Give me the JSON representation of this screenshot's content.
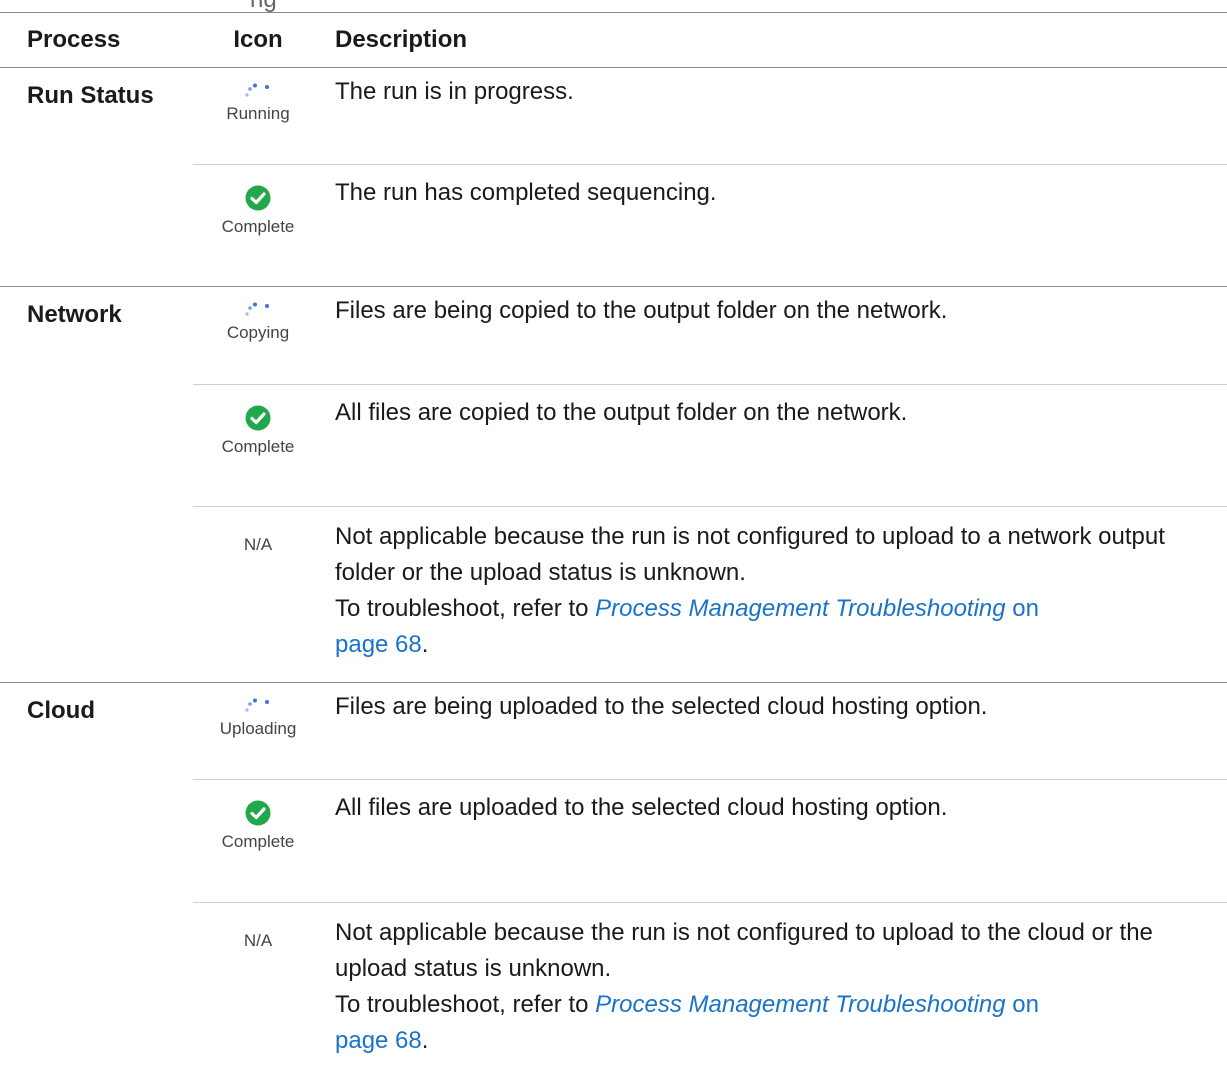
{
  "header": {
    "process": "Process",
    "icon": "Icon",
    "description": "Description"
  },
  "caption_fragment": "ng",
  "groups": {
    "run_status": {
      "label": "Run Status",
      "rows": [
        {
          "icon": "spinner-icon",
          "icon_label": "Running",
          "description": "The run is in progress."
        },
        {
          "icon": "check-circle-icon",
          "icon_label": "Complete",
          "description": "The run has completed sequencing."
        }
      ]
    },
    "network": {
      "label": "Network",
      "rows": [
        {
          "icon": "spinner-icon",
          "icon_label": "Copying",
          "description": "Files are being copied to the output folder on the network."
        },
        {
          "icon": "check-circle-icon",
          "icon_label": "Complete",
          "description": "All files are copied to the output folder on the network."
        },
        {
          "icon": "none",
          "icon_label": "N/A",
          "description": "Not applicable because the run is not configured to upload to a network output folder or the upload status is unknown.",
          "troubleshoot_prefix": "To troubleshoot, refer to ",
          "link_text": "Process Management Troubleshooting",
          "on_text": " on",
          "page_text": "page 68",
          "period": "."
        }
      ]
    },
    "cloud": {
      "label": "Cloud",
      "rows": [
        {
          "icon": "spinner-icon",
          "icon_label": "Uploading",
          "description": "Files are being uploaded to the selected cloud hosting option."
        },
        {
          "icon": "check-circle-icon",
          "icon_label": "Complete",
          "description": "All files are uploaded to the selected cloud hosting option."
        },
        {
          "icon": "none",
          "icon_label": "N/A",
          "description": "Not applicable because the run is not configured to upload to the cloud or the upload status is unknown.",
          "troubleshoot_prefix": "To troubleshoot, refer to ",
          "link_text": "Process Management Troubleshooting",
          "on_text": " on",
          "page_text": "page 68",
          "period": "."
        }
      ]
    }
  },
  "colors": {
    "link": "#1a73c8",
    "check": "#22a84a",
    "spinner": "#4a6ee0"
  }
}
